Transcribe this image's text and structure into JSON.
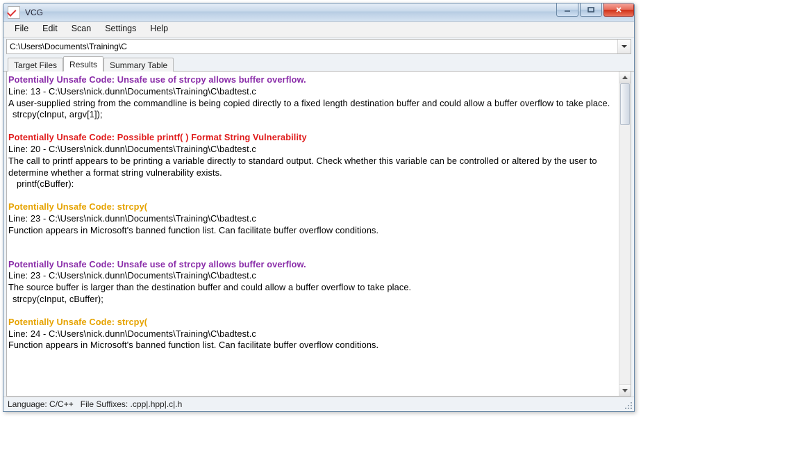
{
  "window": {
    "title": "VCG"
  },
  "menubar": {
    "items": [
      {
        "label": "File"
      },
      {
        "label": "Edit"
      },
      {
        "label": "Scan"
      },
      {
        "label": "Settings"
      },
      {
        "label": "Help"
      }
    ]
  },
  "path": {
    "value": "C:\\Users\\Documents\\Training\\C"
  },
  "tabs": {
    "items": [
      {
        "label": "Target Files",
        "selected": false
      },
      {
        "label": "Results",
        "selected": true
      },
      {
        "label": "Summary Table",
        "selected": false
      }
    ]
  },
  "results": {
    "findings": [
      {
        "severity": "purple",
        "title": "Potentially Unsafe Code: Unsafe use of strcpy allows buffer overflow.",
        "location": "Line: 13 - C:\\Users\\nick.dunn\\Documents\\Training\\C\\badtest.c",
        "description": "A user-supplied string from the commandline is being copied directly to a fixed length destination buffer and could allow a buffer overflow to take place.",
        "code": "strcpy(cInput, argv[1]);"
      },
      {
        "severity": "red",
        "title": "Potentially Unsafe Code: Possible printf( ) Format String Vulnerability",
        "location": "Line: 20 - C:\\Users\\nick.dunn\\Documents\\Training\\C\\badtest.c",
        "description": "The call to printf appears to be printing a variable directly to standard output. Check whether this variable can be controlled or altered by the user to determine whether a format string vulnerability exists.",
        "code": "printf(cBuffer):"
      },
      {
        "severity": "orange",
        "title": "Potentially Unsafe Code: strcpy(",
        "location": "Line: 23 - C:\\Users\\nick.dunn\\Documents\\Training\\C\\badtest.c",
        "description": "Function appears in Microsoft's banned function list. Can facilitate buffer overflow conditions.",
        "code": ""
      },
      {
        "severity": "purple",
        "title": "Potentially Unsafe Code: Unsafe use of strcpy allows buffer overflow.",
        "location": "Line: 23 - C:\\Users\\nick.dunn\\Documents\\Training\\C\\badtest.c",
        "description": "The source buffer is larger than the destination buffer and could allow a buffer overflow to take place.",
        "code": "strcpy(cInput, cBuffer);"
      },
      {
        "severity": "orange",
        "title": "Potentially Unsafe Code: strcpy(",
        "location": "Line: 24 - C:\\Users\\nick.dunn\\Documents\\Training\\C\\badtest.c",
        "description": "Function appears in Microsoft's banned function list. Can facilitate buffer overflow conditions.",
        "code": ""
      }
    ]
  },
  "statusbar": {
    "language_label": "Language: C/C++",
    "suffix_label": "File Suffixes: .cpp|.hpp|.c|.h"
  }
}
